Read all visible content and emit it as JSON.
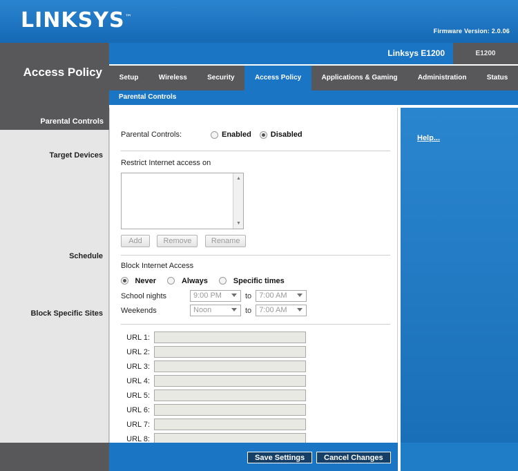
{
  "brand": {
    "logo_text": "LINKSYS",
    "trademark": "™",
    "firmware_label": "Firmware Version: 2.0.06"
  },
  "header": {
    "page_title": "Access Policy",
    "model_primary": "Linksys E1200",
    "model_secondary": "E1200"
  },
  "nav": {
    "tabs": [
      {
        "label": "Setup",
        "active": false
      },
      {
        "label": "Wireless",
        "active": false
      },
      {
        "label": "Security",
        "active": false
      },
      {
        "label": "Access Policy",
        "active": true
      },
      {
        "label": "Applications & Gaming",
        "active": false
      },
      {
        "label": "Administration",
        "active": false
      },
      {
        "label": "Status",
        "active": false
      }
    ],
    "subnav_label": "Parental Controls"
  },
  "sidebar": {
    "heading": "Parental Controls",
    "items": [
      {
        "label": "Target Devices"
      },
      {
        "label": "Schedule"
      },
      {
        "label": "Block Specific Sites"
      }
    ]
  },
  "main": {
    "parental_controls": {
      "label": "Parental Controls:",
      "enabled_label": "Enabled",
      "disabled_label": "Disabled",
      "selected": "Disabled"
    },
    "target_devices": {
      "label": "Restrict Internet access on",
      "list_items": [],
      "buttons": {
        "add": "Add",
        "remove": "Remove",
        "rename": "Rename"
      }
    },
    "schedule": {
      "label": "Block Internet Access",
      "options": [
        {
          "label": "Never",
          "selected": true
        },
        {
          "label": "Always",
          "selected": false
        },
        {
          "label": "Specific times",
          "selected": false
        }
      ],
      "to_label": "to",
      "rows": [
        {
          "label": "School nights",
          "from": "9:00 PM",
          "until": "7:00 AM"
        },
        {
          "label": "Weekends",
          "from": "Noon",
          "until": "7:00 AM"
        }
      ]
    },
    "block_sites": {
      "urls": [
        {
          "label": "URL 1:",
          "value": ""
        },
        {
          "label": "URL 2:",
          "value": ""
        },
        {
          "label": "URL 3:",
          "value": ""
        },
        {
          "label": "URL 4:",
          "value": ""
        },
        {
          "label": "URL 5:",
          "value": ""
        },
        {
          "label": "URL 6:",
          "value": ""
        },
        {
          "label": "URL 7:",
          "value": ""
        },
        {
          "label": "URL 8:",
          "value": ""
        }
      ]
    }
  },
  "help": {
    "link_label": "Help..."
  },
  "footer": {
    "save_label": "Save Settings",
    "cancel_label": "Cancel Changes"
  },
  "colors": {
    "brand_blue": "#1a76c4",
    "dark_gray": "#58585a",
    "sidebar_gray": "#e6e6e6",
    "field_gray": "#e9e9e4"
  }
}
